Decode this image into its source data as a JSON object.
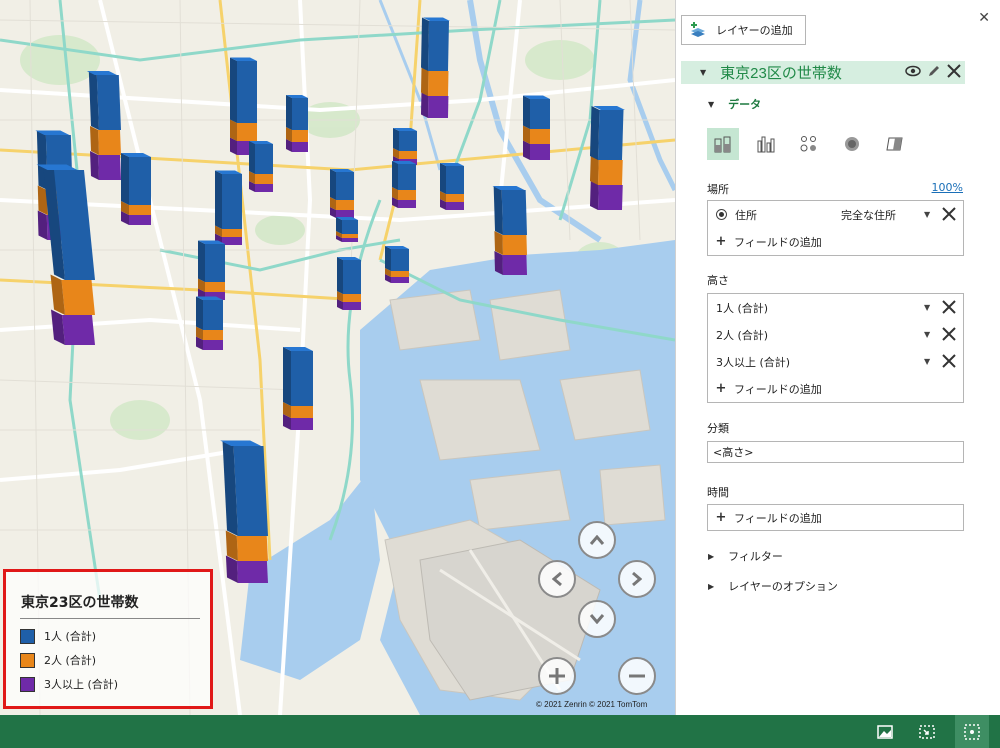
{
  "map": {
    "attribution": "© 2021 Zenrin  © 2021 TomTom",
    "series_colors": {
      "one_person": "#1f5fa8",
      "two_person": "#e8861a",
      "three_plus": "#6f2aa8"
    },
    "water_color": "#a8cdee",
    "land_color": "#f1efe6"
  },
  "legend": {
    "title": "東京23区の世帯数",
    "items": [
      {
        "label": "1人 (合計)",
        "color": "#1f5fa8"
      },
      {
        "label": "2人 (合計)",
        "color": "#e8861a"
      },
      {
        "label": "3人以上 (合計)",
        "color": "#6f2aa8"
      }
    ]
  },
  "panel": {
    "add_layer_label": "レイヤーの追加",
    "layer_name": "東京23区の世帯数",
    "data_section": "データ",
    "location_label": "場所",
    "location_percent": "100%",
    "location_field": "住所",
    "location_type": "完全な住所",
    "add_field": "フィールドの追加",
    "height_label": "高さ",
    "height_fields": [
      "1人 (合計)",
      "2人 (合計)",
      "3人以上 (合計)"
    ],
    "category_label": "分類",
    "category_value": "<高さ>",
    "time_label": "時間",
    "filter_label": "フィルター",
    "layer_options_label": "レイヤーのオプション"
  }
}
